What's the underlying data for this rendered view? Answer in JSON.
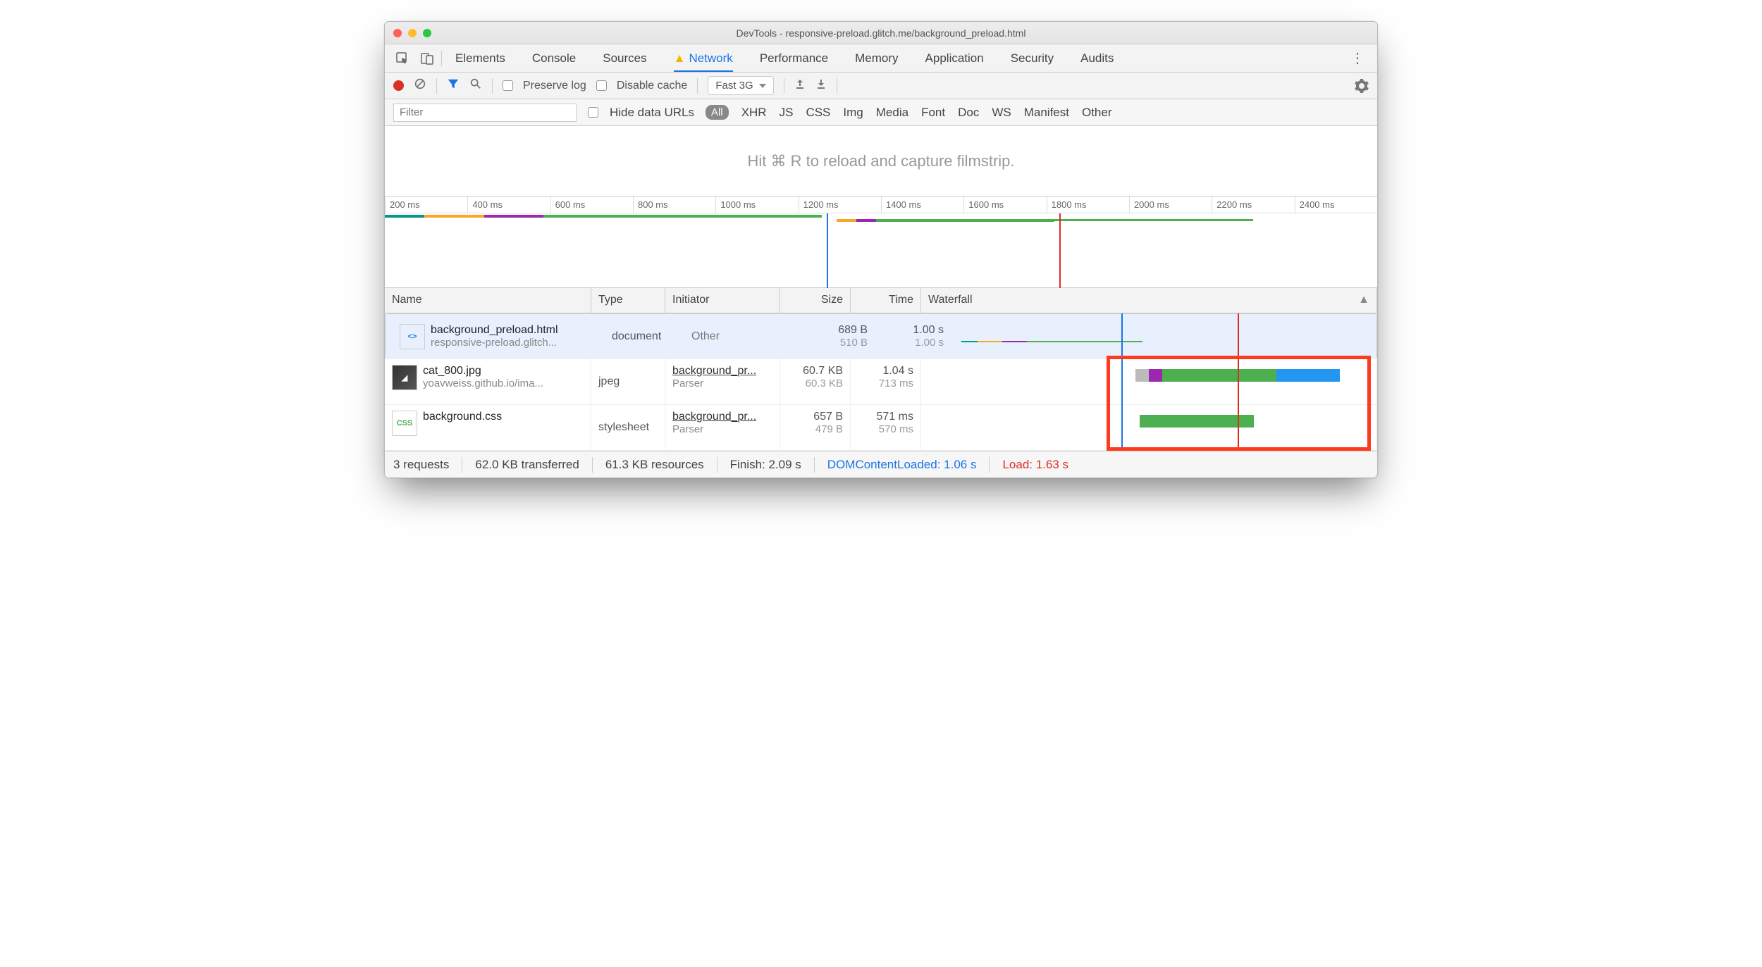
{
  "window_title": "DevTools - responsive-preload.glitch.me/background_preload.html",
  "main_tabs": [
    "Elements",
    "Console",
    "Sources",
    "Network",
    "Performance",
    "Memory",
    "Application",
    "Security",
    "Audits"
  ],
  "active_tab": "Network",
  "toolbar": {
    "preserve_log": "Preserve log",
    "disable_cache": "Disable cache",
    "throttle": "Fast 3G"
  },
  "filter": {
    "placeholder": "Filter",
    "hide_urls": "Hide data URLs",
    "types": [
      "All",
      "XHR",
      "JS",
      "CSS",
      "Img",
      "Media",
      "Font",
      "Doc",
      "WS",
      "Manifest",
      "Other"
    ],
    "active": "All"
  },
  "filmstrip_hint": "Hit ⌘ R to reload and capture filmstrip.",
  "ruler": [
    "200 ms",
    "400 ms",
    "600 ms",
    "800 ms",
    "1000 ms",
    "1200 ms",
    "1400 ms",
    "1600 ms",
    "1800 ms",
    "2000 ms",
    "2200 ms",
    "2400 ms"
  ],
  "columns": {
    "name": "Name",
    "type": "Type",
    "initiator": "Initiator",
    "size": "Size",
    "time": "Time",
    "waterfall": "Waterfall"
  },
  "requests": [
    {
      "icon": "html",
      "name": "background_preload.html",
      "sub": "responsive-preload.glitch...",
      "type": "document",
      "init": "Other",
      "init_sub": "",
      "size": "689 B",
      "size_sub": "510 B",
      "time": "1.00 s",
      "time_sub": "1.00 s"
    },
    {
      "icon": "img",
      "name": "cat_800.jpg",
      "sub": "yoavweiss.github.io/ima...",
      "type": "jpeg",
      "init": "background_pr...",
      "init_sub": "Parser",
      "size": "60.7 KB",
      "size_sub": "60.3 KB",
      "time": "1.04 s",
      "time_sub": "713 ms"
    },
    {
      "icon": "css",
      "name": "background.css",
      "sub": "",
      "type": "stylesheet",
      "init": "background_pr...",
      "init_sub": "Parser",
      "size": "657 B",
      "size_sub": "479 B",
      "time": "571 ms",
      "time_sub": "570 ms"
    }
  ],
  "status": {
    "requests": "3 requests",
    "transferred": "62.0 KB transferred",
    "resources": "61.3 KB resources",
    "finish": "Finish: 2.09 s",
    "dcl": "DOMContentLoaded: 1.06 s",
    "load": "Load: 1.63 s"
  }
}
